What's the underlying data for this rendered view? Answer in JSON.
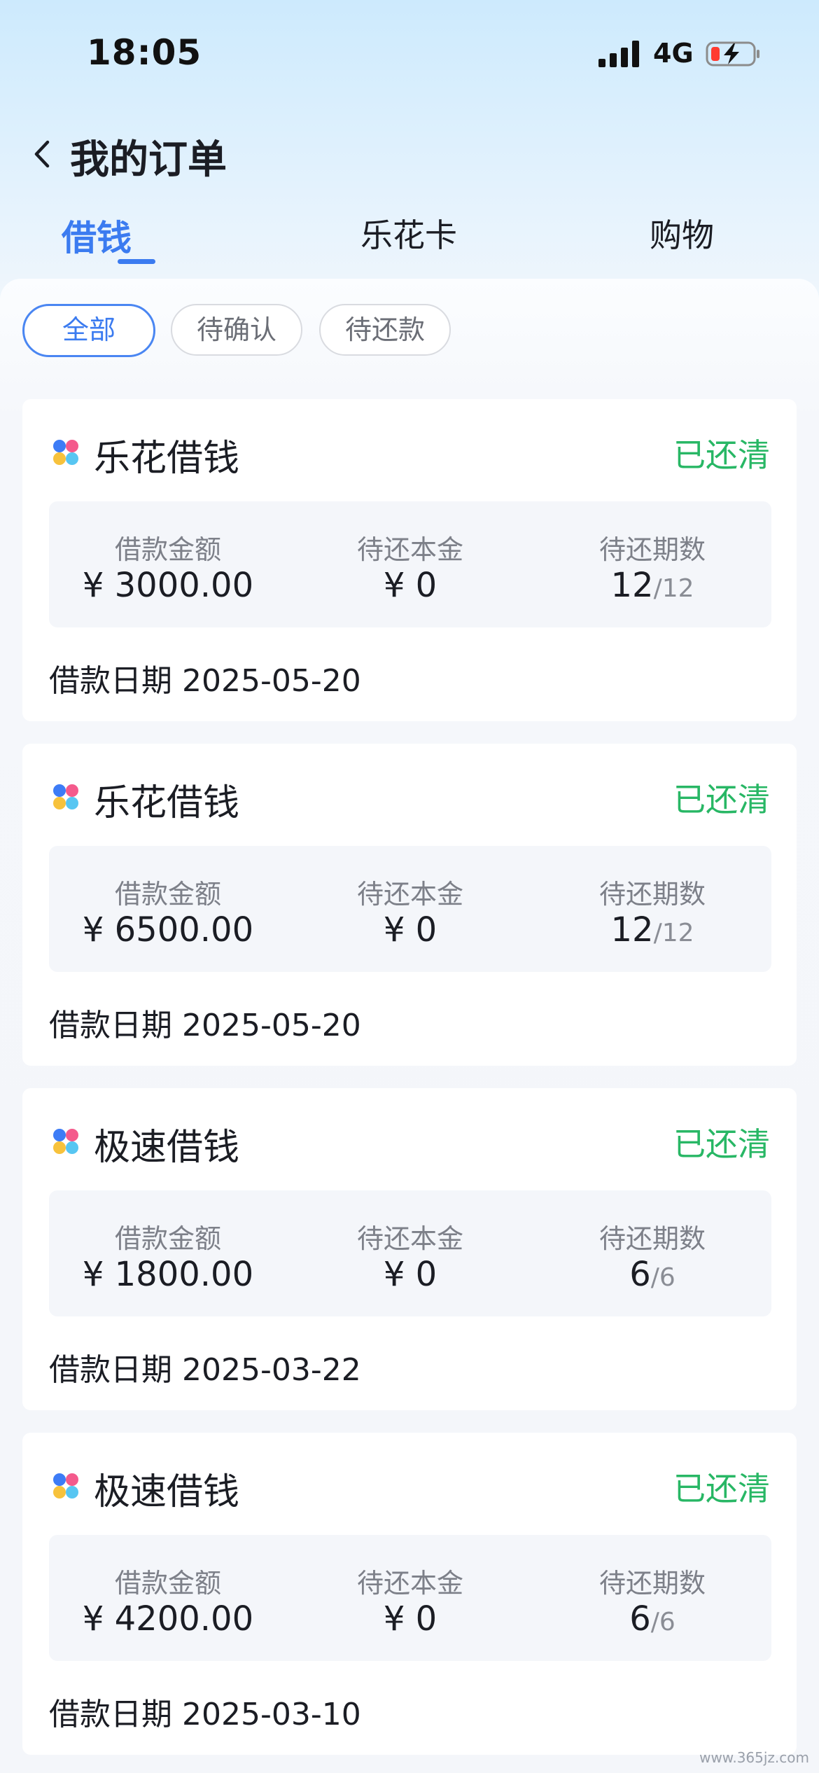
{
  "status_bar": {
    "time": "18:05",
    "network": "4G",
    "battery_color": "#ff3b30"
  },
  "header": {
    "title": "我的订单",
    "back_icon": "chevron-left-icon"
  },
  "tabs": [
    {
      "label": "借钱",
      "active": true
    },
    {
      "label": "乐花卡",
      "active": false
    },
    {
      "label": "购物",
      "active": false
    }
  ],
  "filters": [
    {
      "label": "全部",
      "active": true
    },
    {
      "label": "待确认",
      "active": false
    },
    {
      "label": "待还款",
      "active": false
    }
  ],
  "colors": {
    "accent": "#3b7bf0",
    "status_paid": "#28b765"
  },
  "orders": [
    {
      "product": "乐花借钱",
      "status": "已还清",
      "amount_label": "借款金额",
      "amount": "¥ 3000.00",
      "principal_label": "待还本金",
      "principal": "¥ 0",
      "periods_label": "待还期数",
      "periods_done": "12",
      "periods_total": "/12",
      "date_label": "借款日期",
      "date": "2025-05-20"
    },
    {
      "product": "乐花借钱",
      "status": "已还清",
      "amount_label": "借款金额",
      "amount": "¥ 6500.00",
      "principal_label": "待还本金",
      "principal": "¥ 0",
      "periods_label": "待还期数",
      "periods_done": "12",
      "periods_total": "/12",
      "date_label": "借款日期",
      "date": "2025-05-20"
    },
    {
      "product": "极速借钱",
      "status": "已还清",
      "amount_label": "借款金额",
      "amount": "¥ 1800.00",
      "principal_label": "待还本金",
      "principal": "¥ 0",
      "periods_label": "待还期数",
      "periods_done": "6",
      "periods_total": "/6",
      "date_label": "借款日期",
      "date": "2025-03-22"
    },
    {
      "product": "极速借钱",
      "status": "已还清",
      "amount_label": "借款金额",
      "amount": "¥ 4200.00",
      "principal_label": "待还本金",
      "principal": "¥ 0",
      "periods_label": "待还期数",
      "periods_done": "6",
      "periods_total": "/6",
      "date_label": "借款日期",
      "date": "2025-03-10"
    }
  ],
  "watermark": "www.365jz.com"
}
